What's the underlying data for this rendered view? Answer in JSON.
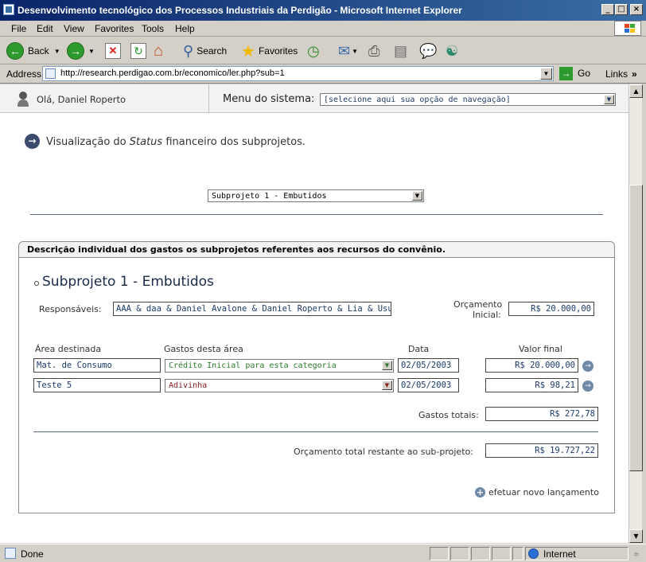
{
  "window": {
    "title": "Desenvolvimento tecnológico dos Processos Industriais da Perdigão - Microsoft Internet Explorer",
    "controls": [
      "_",
      "□",
      "×"
    ]
  },
  "menu": [
    "File",
    "Edit",
    "View",
    "Favorites",
    "Tools",
    "Help"
  ],
  "toolbar": {
    "back": "Back",
    "search": "Search",
    "favorites": "Favorites"
  },
  "address": {
    "label": "Address",
    "url": "http://research.perdigao.com.br/economico/ler.php?sub=1",
    "go": "Go",
    "links": "Links"
  },
  "page": {
    "greeting": "Olá, Daniel Roperto",
    "menu_label": "Menu do sistema:",
    "menu_select": "[selecione aqui sua opção de navegação]",
    "heading_prefix": "Visualização do ",
    "heading_em": "Status",
    "heading_suffix": " financeiro dos subprojetos.",
    "subproject_select": "Subprojeto 1 - Embutidos",
    "panel_title": "Descrição individual dos gastos os subprojetos referentes aos recursos do convênio.",
    "subproject_title": "Subprojeto 1 - Embutidos",
    "responsaveis_label": "Responsáveis:",
    "responsaveis_value": "AAA & daa & Daniel Avalone & Daniel Roperto & Lia & Usuarios",
    "orcamento_label_1": "Orçamento",
    "orcamento_label_2": "Inicial:",
    "orcamento_value": "R$ 20.000,00",
    "columns": [
      "Área destinada",
      "Gastos desta área",
      "Data",
      "Valor final"
    ],
    "rows": [
      {
        "area": "Mat. de Consumo",
        "gasto": "Crédito Inicial para esta categoria",
        "data": "02/05/2003",
        "valor": "R$ 20.000,00"
      },
      {
        "area": "Teste 5",
        "gasto": "Adivinha",
        "data": "02/05/2003",
        "valor": "R$ 98,21"
      }
    ],
    "gastos_totais_label": "Gastos totais:",
    "gastos_totais_value": "R$ 272,78",
    "restante_label": "Orçamento total restante ao sub-projeto:",
    "restante_value": "R$ 19.727,22",
    "novo_lancamento": "efetuar novo lançamento"
  },
  "status": {
    "text": "Done",
    "zone": "Internet"
  },
  "colors": {
    "titlebar": "#0a246a",
    "credit_text": "#2a7a2a",
    "debit_text": "#8a1a1a",
    "field_text": "#1a3a6a"
  }
}
